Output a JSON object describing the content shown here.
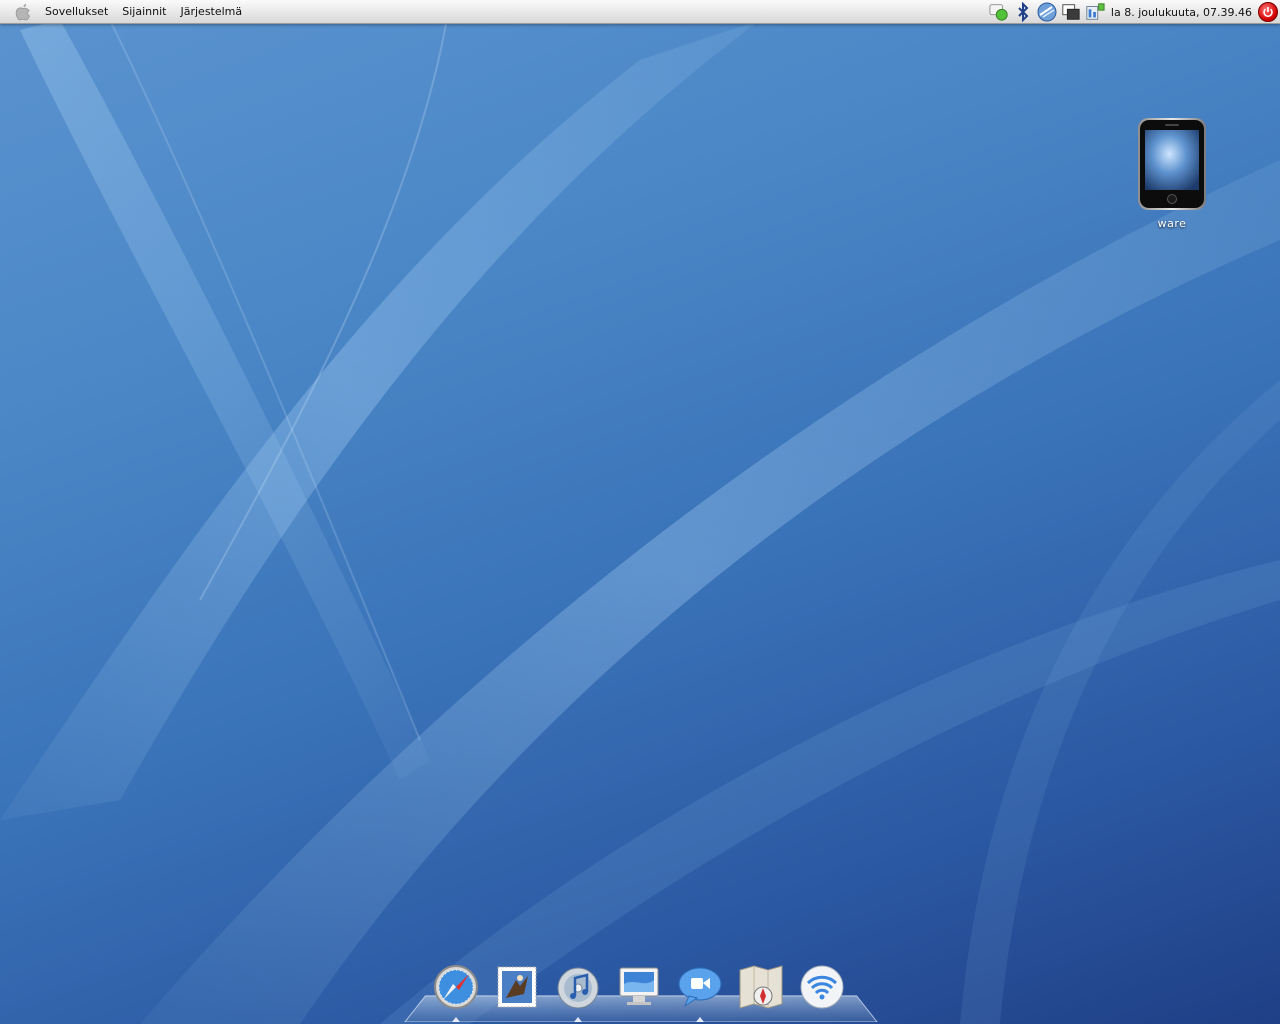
{
  "top_panel": {
    "menus": [
      {
        "label": "Sovellukset"
      },
      {
        "label": "Sijainnit"
      },
      {
        "label": "Järjestelmä"
      }
    ],
    "clock": "la  8. joulukuuta, 07.39.46"
  },
  "tray_icons": [
    "chat-status-icon",
    "bluetooth-icon",
    "network-globe-icon",
    "workspace-switcher-icon",
    "network-monitor-icon",
    "power-icon"
  ],
  "desktop": {
    "icons": [
      {
        "label": "ware",
        "icon": "iphone-icon"
      }
    ]
  },
  "dock": {
    "items": [
      {
        "name": "safari",
        "icon": "compass-icon",
        "running": true
      },
      {
        "name": "mail",
        "icon": "mail-stamp-icon",
        "running": false
      },
      {
        "name": "itunes",
        "icon": "music-cd-icon",
        "running": true
      },
      {
        "name": "display",
        "icon": "monitor-icon",
        "running": false
      },
      {
        "name": "ichat",
        "icon": "video-chat-icon",
        "running": true
      },
      {
        "name": "maps",
        "icon": "map-compass-icon",
        "running": false
      },
      {
        "name": "wireless",
        "icon": "wifi-icon",
        "running": false
      }
    ]
  },
  "colors": {
    "wallpaper_top": "#5b93cf",
    "wallpaper_bottom": "#1f3f86",
    "panel": "#e6e6e6",
    "power": "#d40000"
  }
}
